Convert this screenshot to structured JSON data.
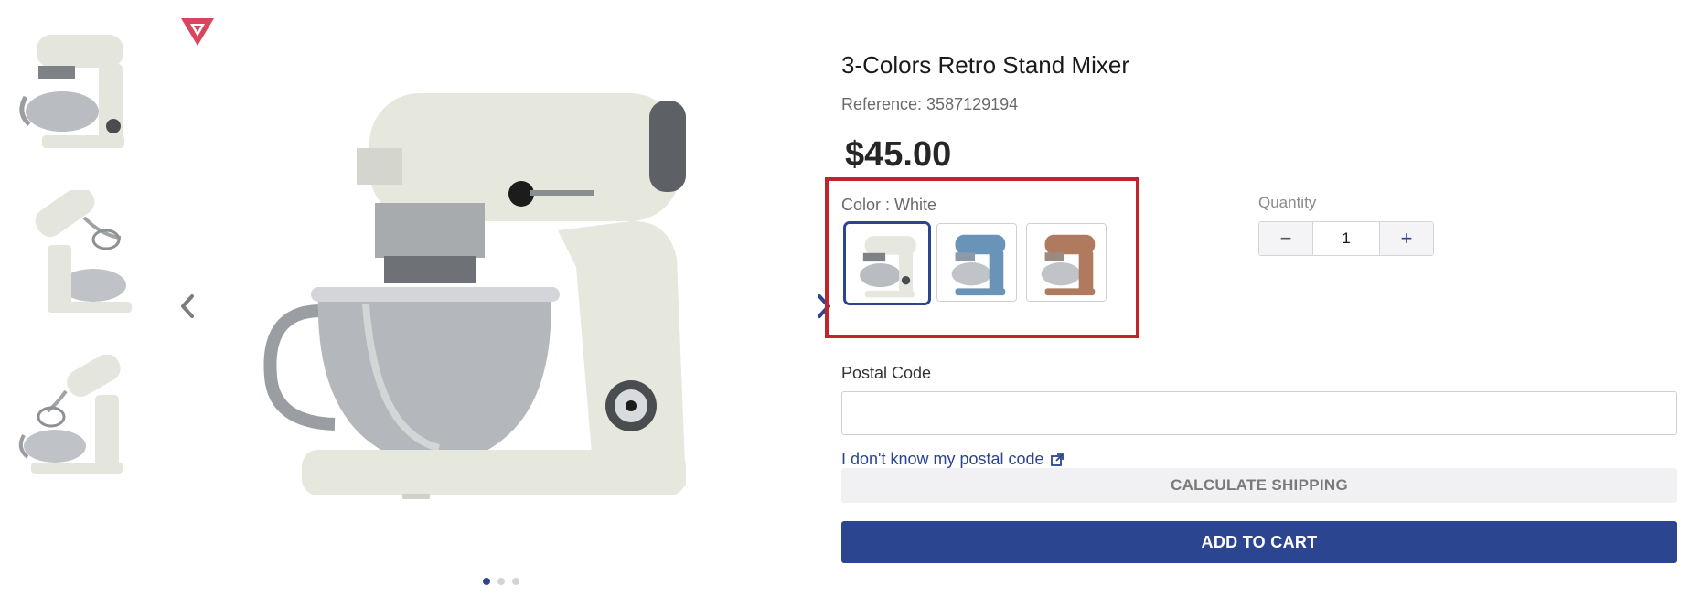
{
  "gallery": {
    "thumbnails": [
      {
        "alt": "mixer-front-icon"
      },
      {
        "alt": "mixer-tilted-icon"
      },
      {
        "alt": "mixer-raised-icon"
      }
    ],
    "badge_icon": "brand-triangle-icon",
    "prev_icon": "chevron-left-icon",
    "next_icon": "chevron-right-icon",
    "dots_count": 3,
    "active_dot": 0
  },
  "product": {
    "title": "3-Colors Retro Stand Mixer",
    "reference": "Reference: 3587129194",
    "price": "$45.00"
  },
  "color": {
    "label": "Color : White",
    "options": [
      {
        "name": "White",
        "hex": "#e6e8df"
      },
      {
        "name": "Blue",
        "hex": "#6a93b8"
      },
      {
        "name": "Copper",
        "hex": "#b07a5e"
      }
    ],
    "selected_index": 0
  },
  "quantity": {
    "label": "Quantity",
    "value": "1",
    "minus": "−",
    "plus": "+"
  },
  "postal": {
    "label": "Postal Code",
    "placeholder": "",
    "link_text": "I don't know my postal code",
    "link_icon": "external-link-icon"
  },
  "actions": {
    "shipping": "CALCULATE SHIPPING",
    "cart": "ADD TO CART"
  },
  "colors": {
    "accent": "#2b4590",
    "highlight_border": "#c0252b",
    "badge": "#d9445f"
  }
}
